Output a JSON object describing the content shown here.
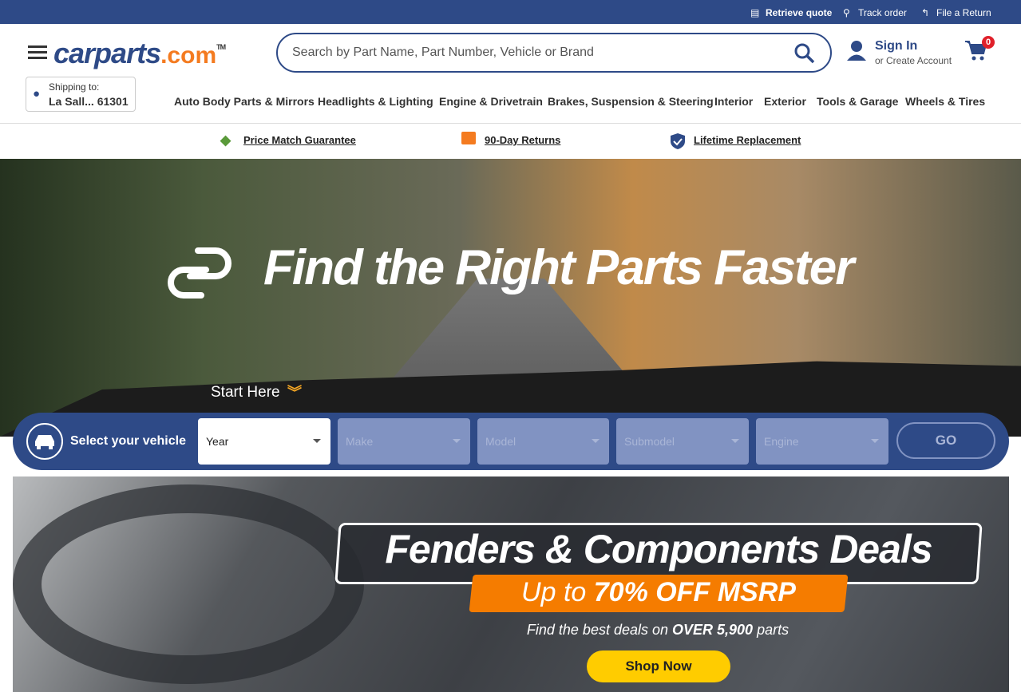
{
  "topbar": {
    "retrieve_quote": "Retrieve quote",
    "track_order": "Track order",
    "file_return": "File a Return"
  },
  "header": {
    "logo_main": "carparts",
    "logo_suffix": ".com",
    "logo_tm": "TM",
    "search_placeholder": "Search by Part Name, Part Number, Vehicle or Brand",
    "sign_in": "Sign In",
    "create_account": "or Create Account",
    "cart_count": "0",
    "shipping_label": "Shipping to:",
    "shipping_location": "La Sall... 61301"
  },
  "nav": [
    "Auto Body Parts & Mirrors",
    "Headlights & Lighting",
    "Engine & Drivetrain",
    "Brakes, Suspension & Steering",
    "Interior",
    "Exterior",
    "Tools & Garage",
    "Wheels & Tires"
  ],
  "value_props": [
    "Price Match Guarantee",
    "90-Day Returns",
    "Lifetime Replacement"
  ],
  "hero": {
    "title": "Find the Right Parts Faster",
    "start_here": "Start Here"
  },
  "vehicle_selector": {
    "label": "Select your vehicle",
    "selects": [
      "Year",
      "Make",
      "Model",
      "Submodel",
      "Engine"
    ],
    "go": "GO"
  },
  "promo": {
    "title": "Fenders & Components Deals",
    "sub_prefix": "Up to ",
    "sub_bold": "70% OFF MSRP",
    "desc_prefix": "Find the best deals on ",
    "desc_bold": "OVER 5,900",
    "desc_suffix": " parts",
    "cta": "Shop Now"
  },
  "colors": {
    "brand": "#2e4a87",
    "accent": "#f47b20",
    "cta": "#ffcc00",
    "badge": "#e0202a"
  }
}
